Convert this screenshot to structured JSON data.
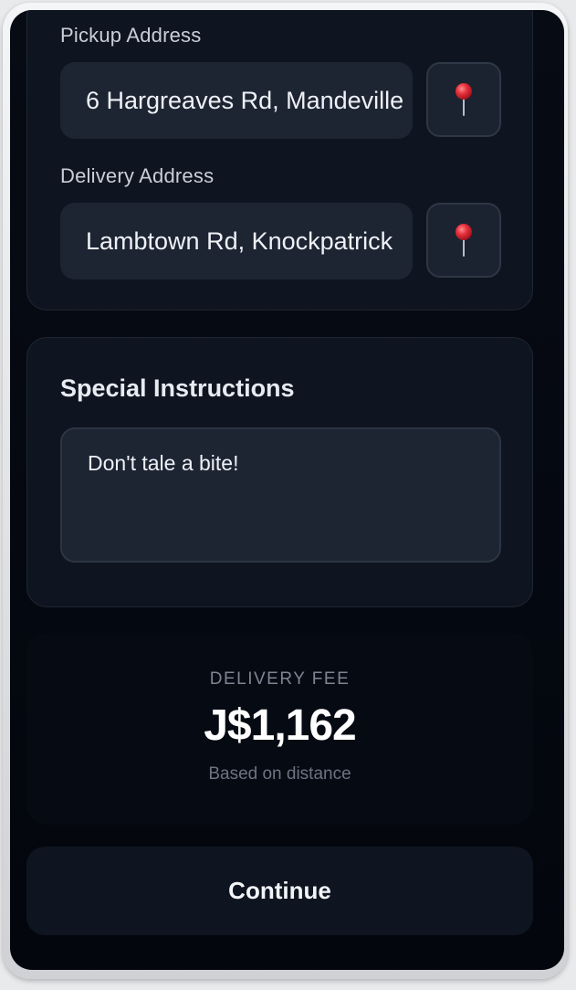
{
  "address_card": {
    "pickup_label": "Pickup Address",
    "pickup_value": "6 Hargreaves Rd, Mandeville",
    "delivery_label": "Delivery Address",
    "delivery_value": "Lambtown Rd, Knockpatrick",
    "pin_icon": "pushpin-icon"
  },
  "instructions": {
    "title": "Special Instructions",
    "value": "Don't tale a bite!"
  },
  "fee": {
    "label": "DELIVERY FEE",
    "amount": "J$1,162",
    "note": "Based on distance"
  },
  "continue_label": "Continue",
  "colors": {
    "background": "#03060d",
    "card": "#0f1520",
    "input": "#1d2533",
    "pin_red": "#e5303b"
  }
}
